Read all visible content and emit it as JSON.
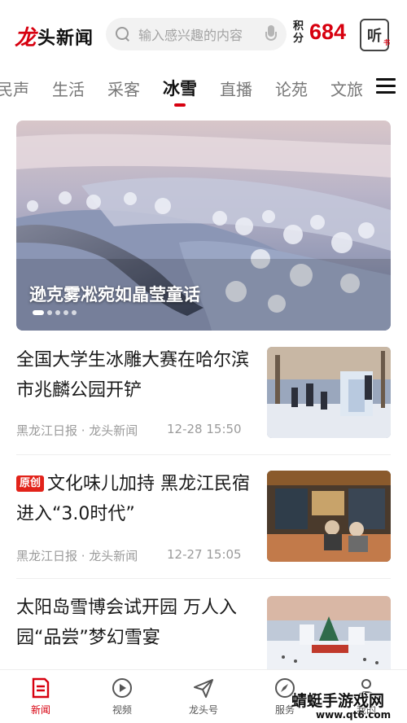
{
  "app": {
    "logo_mark": "龙",
    "logo_text": "头新闻"
  },
  "search": {
    "placeholder": "输入感兴趣的内容"
  },
  "points": {
    "label": "积分",
    "value": "684"
  },
  "listen": {
    "label": "听",
    "sub": "书"
  },
  "tabs": [
    {
      "label": "民声"
    },
    {
      "label": "生活"
    },
    {
      "label": "采客"
    },
    {
      "label": "冰雪",
      "active": true
    },
    {
      "label": "直播"
    },
    {
      "label": "论苑"
    },
    {
      "label": "文旅"
    }
  ],
  "hero": {
    "title": "逊克雾凇宛如晶莹童话",
    "slide_count": 5,
    "active_slide": 1
  },
  "news": [
    {
      "title": "全国大学生冰雕大赛在哈尔滨市兆麟公园开铲",
      "badge": "",
      "source": "黑龙江日报 · 龙头新闻",
      "time": "12-28  15:50"
    },
    {
      "title": "文化味儿加持  黑龙江民宿进入“3.0时代”",
      "badge": "原创",
      "source": "黑龙江日报 · 龙头新闻",
      "time": "12-27  15:05"
    },
    {
      "title": "太阳岛雪博会试开园  万人入园“品尝”梦幻雪宴",
      "badge": "",
      "source": "",
      "time": ""
    }
  ],
  "bottom_nav": [
    {
      "label": "新闻",
      "icon": "news-icon",
      "active": true
    },
    {
      "label": "视频",
      "icon": "video-icon"
    },
    {
      "label": "龙头号",
      "icon": "send-icon"
    },
    {
      "label": "服务",
      "icon": "compass-icon"
    },
    {
      "label": "我的",
      "icon": "user-icon"
    }
  ],
  "watermark": {
    "main": "蜻蜓手游戏网",
    "sub": "www.qt6.com"
  },
  "colors": {
    "brand_red": "#d7000f",
    "badge_red": "#e2231a"
  }
}
